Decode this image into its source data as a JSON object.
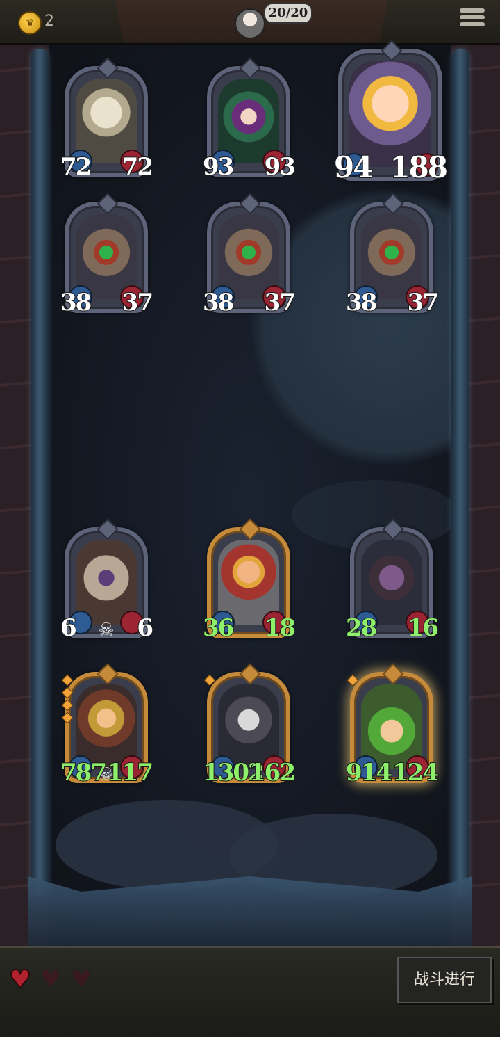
{
  "topbar": {
    "coins": "2",
    "party_count": "20/20",
    "coin_icon": "crown-coin-icon",
    "menu_icon": "hamburger-menu-icon",
    "avatar_icon": "player-avatar-icon"
  },
  "enemy_cards": [
    {
      "name": "chef-ghost",
      "attack": "72",
      "health": "72"
    },
    {
      "name": "witch",
      "attack": "93",
      "health": "93"
    },
    {
      "name": "screaming-boy",
      "attack": "94",
      "health": "188"
    },
    {
      "name": "carnivorous-bug-1",
      "attack": "38",
      "health": "37"
    },
    {
      "name": "carnivorous-bug-2",
      "attack": "38",
      "health": "37"
    },
    {
      "name": "carnivorous-bug-3",
      "attack": "38",
      "health": "37"
    }
  ],
  "player_cards": [
    {
      "name": "owl-mummy",
      "attack": "6",
      "health": "6"
    },
    {
      "name": "blonde-warrior",
      "attack": "36",
      "health": "18"
    },
    {
      "name": "octopus-cook",
      "attack": "28",
      "health": "16"
    },
    {
      "name": "pirate-captain",
      "attack": "787",
      "health": "117"
    },
    {
      "name": "grey-cat",
      "attack": "1302",
      "health": "162"
    },
    {
      "name": "leaf-child",
      "attack": "914",
      "health": "124"
    }
  ],
  "lives": {
    "full": 1,
    "total": 3
  },
  "battle_button": "战斗进行",
  "colors": {
    "gold_frame": "#c58a3a",
    "silver_frame": "#5d6378",
    "buffed_stat": "#8ef06a",
    "heart": "#b0222e"
  }
}
